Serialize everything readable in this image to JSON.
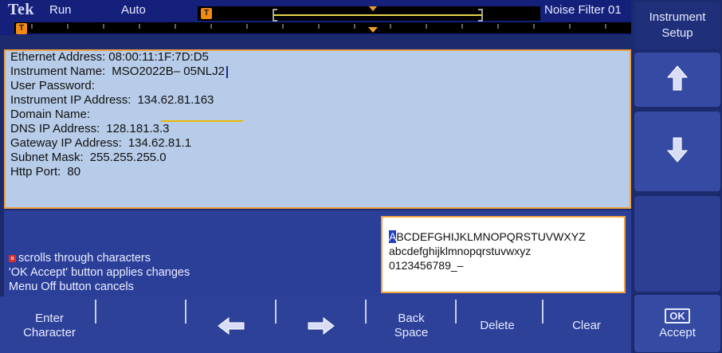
{
  "status": {
    "brand": "Tek",
    "run_state": "Run",
    "trigger_mode": "Auto",
    "noise_filter": "Noise Filter 01",
    "trigger_marker": "T"
  },
  "side_menu": {
    "title_line1": "Instrument",
    "title_line2": "Setup",
    "up_icon": "up-arrow-icon",
    "down_icon": "down-arrow-icon",
    "ok_box": "OK",
    "ok_label": "Accept"
  },
  "info": {
    "ethernet_label": "Ethernet Address:",
    "ethernet_value": "08:00:11:1F:7D:D5",
    "name_label": "Instrument Name:",
    "name_value": "MSO2022B– 05NLJ2",
    "password_label": "User Password:",
    "ip_label": "Instrument IP Address:",
    "ip_value": "134.62.81.163",
    "domain_label": "Domain Name:",
    "dns_label": "DNS IP Address:",
    "dns_value": "128.181.3.3",
    "gateway_label": "Gateway IP Address:",
    "gateway_value": "134.62.81.1",
    "subnet_label": "Subnet Mask:",
    "subnet_value": "255.255.255.0",
    "http_label": "Http Port:",
    "http_value": "80"
  },
  "help": {
    "knob_glyph": "a",
    "line1": "scrolls through characters",
    "line2": "'OK Accept' button applies changes",
    "line3": "Menu Off button cancels"
  },
  "palette": {
    "first_char": "A",
    "line1_rest": "BCDEFGHIJKLMNOPQRSTUVWXYZ",
    "line2": "abcdefghijklmnopqrstuvwxyz",
    "line3": "0123456789_–"
  },
  "soft_keys": {
    "enter_line1": "Enter",
    "enter_line2": "Character",
    "left_icon": "left-arrow-icon",
    "right_icon": "right-arrow-icon",
    "back_line1": "Back",
    "back_line2": "Space",
    "delete": "Delete",
    "clear": "Clear"
  },
  "colors": {
    "panel_bg": "#b7cce9",
    "panel_border": "#f0a040",
    "screen_bg": "#1c2a6e",
    "marker": "#f08a10",
    "trigger_line": "#e8d44a"
  }
}
